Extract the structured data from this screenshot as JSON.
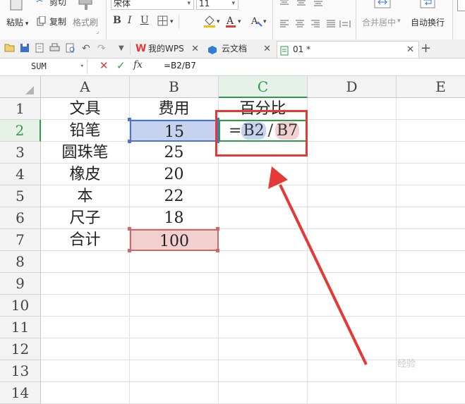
{
  "ribbon": {
    "paste_label": "粘贴",
    "cut_label": "剪切",
    "copy_label": "复制",
    "format_painter_label": "格式刷",
    "font_name": "宋体",
    "font_size": "11",
    "merge_center_label": "合并居中",
    "wrap_text_label": "自动换行"
  },
  "tabs": [
    {
      "label": "我的WPS"
    },
    {
      "label": "云文档"
    },
    {
      "label": "01 *"
    }
  ],
  "formula_bar": {
    "name_box": "SUM",
    "fx": "fx",
    "formula": "=B2/B7"
  },
  "columns": [
    "A",
    "B",
    "C",
    "D",
    "E"
  ],
  "rows": [
    "1",
    "2",
    "3",
    "4",
    "5",
    "6",
    "7",
    "8",
    "9",
    "10",
    "11",
    "12",
    "13",
    "14"
  ],
  "cells": {
    "A1": "文具",
    "B1": "费用",
    "C1": "百分比",
    "A2": "铅笔",
    "B2": "15",
    "A3": "圆珠笔",
    "B3": "25",
    "A4": "橡皮",
    "B4": "20",
    "A5": "本",
    "B5": "22",
    "A6": "尺子",
    "B6": "18",
    "A7": "合计",
    "B7": "100"
  },
  "edit_formula": {
    "eq": "=",
    "ref1": "B2",
    "op": "/",
    "ref2": "B7"
  },
  "colors": {
    "ref1_fill": "#c6d3f0",
    "ref2_fill": "#f2d0d0",
    "annotation_red": "#e53935",
    "active_header": "#2e9a4a"
  },
  "watermark": "经验"
}
